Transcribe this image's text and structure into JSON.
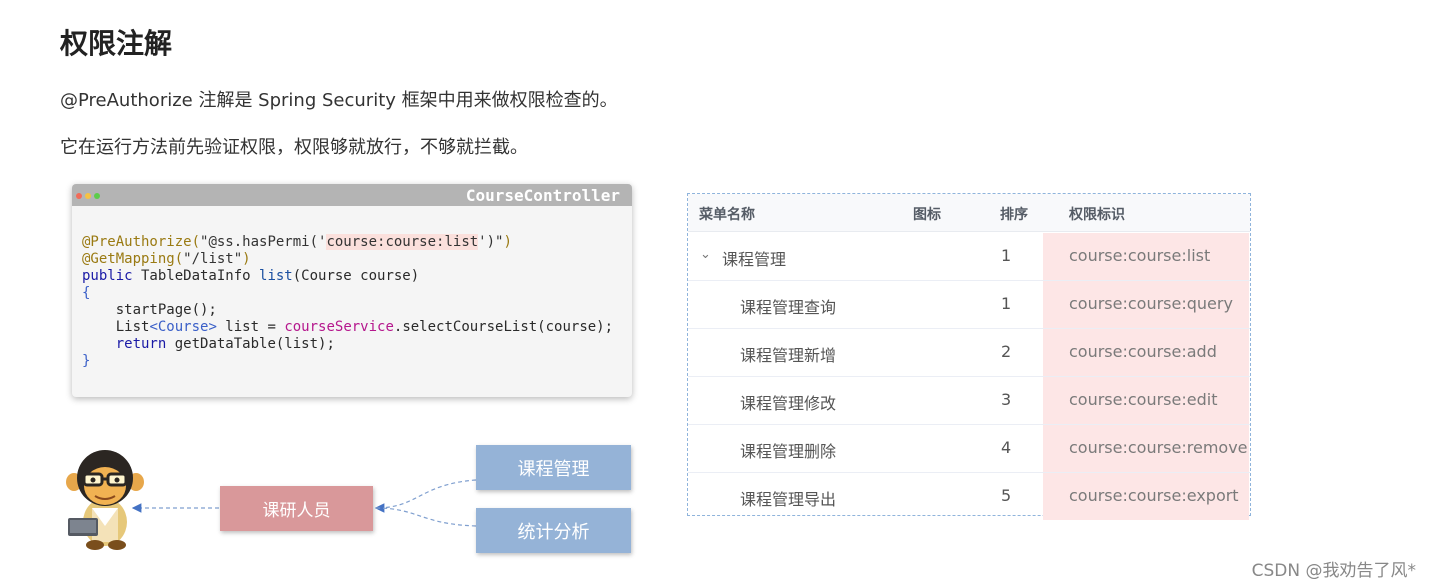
{
  "heading": "权限注解",
  "paragraph1": "@PreAuthorize 注解是 Spring Security 框架中用来做权限检查的。",
  "paragraph2": "它在运行方法前先验证权限，权限够就放行，不够就拦截。",
  "code": {
    "title": "CourseController",
    "l1a": "@PreAuthorize(",
    "l1b": "\"@ss.hasPermi('",
    "l1c": "course:course:list",
    "l1d": "')\"",
    "l1e": ")",
    "l2a": "@GetMapping(",
    "l2b": "\"/list\"",
    "l2c": ")",
    "l3a": "public",
    "l3b": " TableDataInfo ",
    "l3c": "list",
    "l3d": "(Course course)",
    "l4": "{",
    "l5a": "    startPage",
    "l5b": "();",
    "l6a": "    List",
    "l6b": "<Course>",
    "l6c": " list = ",
    "l6d": "courseService",
    "l6e": ".selectCourseList(course);",
    "l7a": "    return",
    "l7b": " getDataTable(list);",
    "l8": "}"
  },
  "diagram": {
    "role": "课研人员",
    "menu1": "课程管理",
    "menu2": "统计分析"
  },
  "table": {
    "headers": {
      "name": "菜单名称",
      "icon": "图标",
      "sort": "排序",
      "perm": "权限标识"
    },
    "rows": [
      {
        "name": "课程管理",
        "sort": "1",
        "perm": "course:course:list"
      },
      {
        "name": "课程管理查询",
        "sort": "1",
        "perm": "course:course:query"
      },
      {
        "name": "课程管理新增",
        "sort": "2",
        "perm": "course:course:add"
      },
      {
        "name": "课程管理修改",
        "sort": "3",
        "perm": "course:course:edit"
      },
      {
        "name": "课程管理删除",
        "sort": "4",
        "perm": "course:course:remove"
      },
      {
        "name": "课程管理导出",
        "sort": "5",
        "perm": "course:course:export"
      }
    ]
  },
  "watermark": "CSDN @我劝告了风*",
  "colors": {
    "role_box": "#d9989a",
    "menu_box": "#95b3d7",
    "perm_highlight": "#fde6e6",
    "table_border": "#8fb4dc"
  }
}
